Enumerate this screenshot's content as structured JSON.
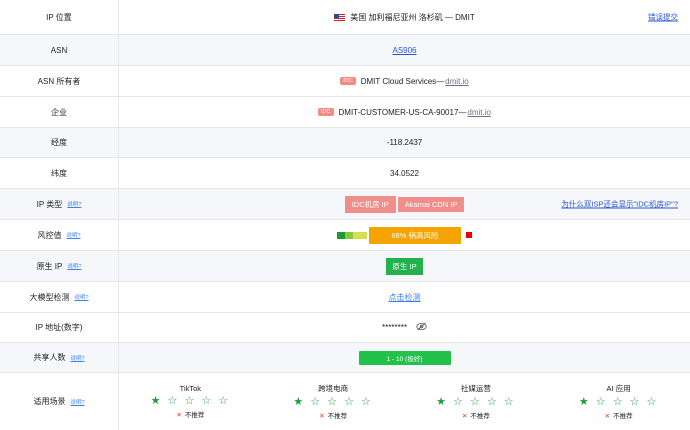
{
  "rows": {
    "ip_location": {
      "label": "IP 位置",
      "value": "美国 加利福尼亚州 洛杉矶 — DMIT",
      "link": "错误提交"
    },
    "asn": {
      "label": "ASN",
      "value": "AS906"
    },
    "asn_owner": {
      "label": "ASN 所有者",
      "badge": "IDC",
      "value": "DMIT Cloud Services—",
      "domain": "dmit.io"
    },
    "company": {
      "label": "企业",
      "badge": "IDC",
      "value": "DMIT-CUSTOMER-US-CA-90017—",
      "domain": "dmit.io"
    },
    "longitude": {
      "label": "经度",
      "value": "-118.2437"
    },
    "latitude": {
      "label": "纬度",
      "value": "34.0522"
    },
    "ip_type": {
      "label": "IP 类型",
      "help": "说明?",
      "tags": [
        "IDC机房 IP",
        "Akamai CDN IP"
      ],
      "link": "为什么双ISP还会显示\"IDC机房IP\"?"
    },
    "risk": {
      "label": "风控值",
      "help": "说明?",
      "value": "68%  稍高风险",
      "level_percent": 68,
      "colors": {
        "seg1": "#1a9e2a",
        "seg2": "#8cc63f",
        "seg3": "#d6e04a",
        "bar": "#f4a300",
        "marker": "#e00000"
      }
    },
    "native_ip": {
      "label": "原生 IP",
      "help": "说明?",
      "value": "原生 IP"
    },
    "llm": {
      "label": "大模型检测",
      "help": "说明?",
      "value": "点击检测"
    },
    "ip_number": {
      "label": "IP 地址(数字)",
      "value": "********"
    },
    "shared": {
      "label": "共享人数",
      "help": "说明?",
      "value": "1 - 10 (极好)"
    },
    "scenarios": {
      "label": "适用场景",
      "help": "说明?",
      "not_recommended": "不推荐",
      "stars": "★ ☆ ☆ ☆ ☆",
      "rating": 1,
      "items": [
        "TikTok",
        "跨境电商",
        "社媒运营",
        "AI 应用"
      ]
    }
  },
  "colors": {
    "link": "#2b55d4",
    "green": "#22b14c",
    "tag_red": "#ef8e8a",
    "star_green": "#1e9e3a"
  }
}
